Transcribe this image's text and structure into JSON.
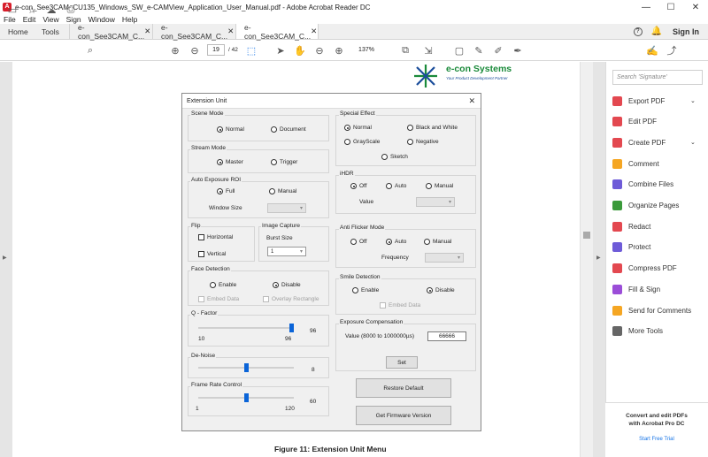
{
  "window": {
    "title": "e-con_See3CAM_CU135_Windows_SW_e-CAMView_Application_User_Manual.pdf - Adobe Acrobat Reader DC",
    "minimize": "—",
    "maximize": "☐",
    "close": "✕"
  },
  "menu": [
    "File",
    "Edit",
    "View",
    "Sign",
    "Window",
    "Help"
  ],
  "tabs": {
    "home": "Home",
    "tools": "Tools",
    "docs": [
      {
        "label": "e-con_See3CAM_C...",
        "close": "✕"
      },
      {
        "label": "e-con_See3CAM_C...",
        "close": "✕"
      },
      {
        "label": "e-con_See3CAM_C...",
        "close": "✕"
      }
    ],
    "help": "?",
    "signin": "Sign In"
  },
  "toolbar": {
    "page_current": "19",
    "page_total": "/ 42",
    "zoom": "137%"
  },
  "logo": {
    "name": "e-con Systems",
    "tagline": "Your Product Development Partner"
  },
  "dialog": {
    "title": "Extension Unit",
    "close": "✕",
    "scene_mode": {
      "label": "Scene Mode",
      "opt1": "Normal",
      "opt2": "Document"
    },
    "stream_mode": {
      "label": "Stream Mode",
      "opt1": "Master",
      "opt2": "Trigger"
    },
    "auto_exposure": {
      "label": "Auto Exposure ROI",
      "opt1": "Full",
      "opt2": "Manual",
      "window_size": "Window Size"
    },
    "flip": {
      "label": "Flip",
      "horizontal": "Horizontal",
      "vertical": "Vertical"
    },
    "image_capture": {
      "label": "Image Capture",
      "burst_size": "Burst Size",
      "burst_value": "1"
    },
    "face_detection": {
      "label": "Face Detection",
      "enable": "Enable",
      "disable": "Disable",
      "embed": "Embed Data",
      "overlay": "Overlay Rectangle"
    },
    "q_factor": {
      "label": "Q - Factor",
      "value": "96",
      "min": "10",
      "max": "96",
      "fraction": 0.98
    },
    "denoise": {
      "label": "De-Noise",
      "value": "8",
      "fraction": 0.5
    },
    "frame_rate": {
      "label": "Frame Rate Control",
      "value": "60",
      "min": "1",
      "max": "120",
      "fraction": 0.5
    },
    "special_effect": {
      "label": "Special Effect",
      "normal": "Normal",
      "bw": "Black and White",
      "grayscale": "GrayScale",
      "negative": "Negative",
      "sketch": "Sketch"
    },
    "ihdr": {
      "label": "iHDR",
      "off": "Off",
      "auto": "Auto",
      "manual": "Manual",
      "value": "Value"
    },
    "anti_flicker": {
      "label": "Anti Flicker Mode",
      "off": "Off",
      "auto": "Auto",
      "manual": "Manual",
      "frequency": "Frequency"
    },
    "smile": {
      "label": "Smile Detection",
      "enable": "Enable",
      "disable": "Disable",
      "embed": "Embed Data"
    },
    "exposure": {
      "label": "Exposure Compensation",
      "range": "Value (8000 to 1000000µs)",
      "value": "66666",
      "set": "Set"
    },
    "restore": "Restore Default",
    "firmware": "Get Firmware Version"
  },
  "caption": "Figure 11: Extension Unit Menu",
  "right_panel": {
    "search_placeholder": "Search 'Signature'",
    "tools": [
      {
        "label": "Export PDF",
        "color": "#e34850"
      },
      {
        "label": "Edit PDF",
        "color": "#e34850"
      },
      {
        "label": "Create PDF",
        "color": "#e34850"
      },
      {
        "label": "Comment",
        "color": "#f5a623"
      },
      {
        "label": "Combine Files",
        "color": "#6e5bd8"
      },
      {
        "label": "Organize Pages",
        "color": "#3a9a3a"
      },
      {
        "label": "Redact",
        "color": "#e34850"
      },
      {
        "label": "Protect",
        "color": "#6e5bd8"
      },
      {
        "label": "Compress PDF",
        "color": "#e34850"
      },
      {
        "label": "Fill & Sign",
        "color": "#9b4dd8"
      },
      {
        "label": "Send for Comments",
        "color": "#f5a623"
      },
      {
        "label": "More Tools",
        "color": "#666666"
      }
    ],
    "promo_line1": "Convert and edit PDFs",
    "promo_line2": "with Acrobat Pro DC",
    "promo_link": "Start Free Trial"
  }
}
